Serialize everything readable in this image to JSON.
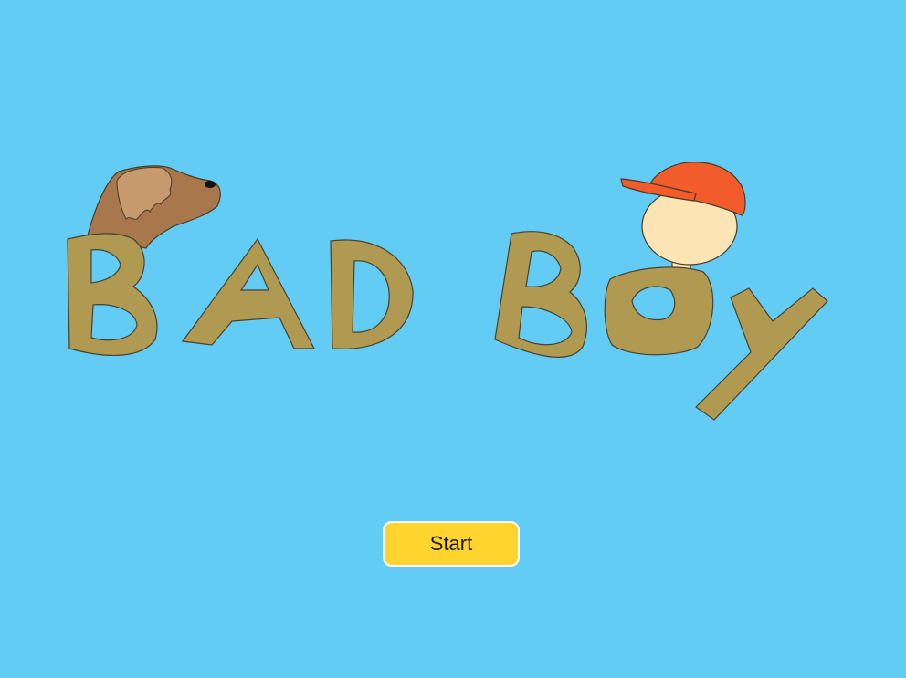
{
  "title": {
    "text": "BAD BOY",
    "letter_color": "#b09a52"
  },
  "characters": {
    "dog_head_icon": "dog-head-icon",
    "boy_head_icon": "boy-with-red-cap-icon",
    "dog_color": "#a8784c",
    "cap_color": "#f25b2a",
    "skin_color": "#fde4b4"
  },
  "start_button": {
    "label": "Start",
    "color": "#ffd42e"
  },
  "background_color": "#62ccf5"
}
